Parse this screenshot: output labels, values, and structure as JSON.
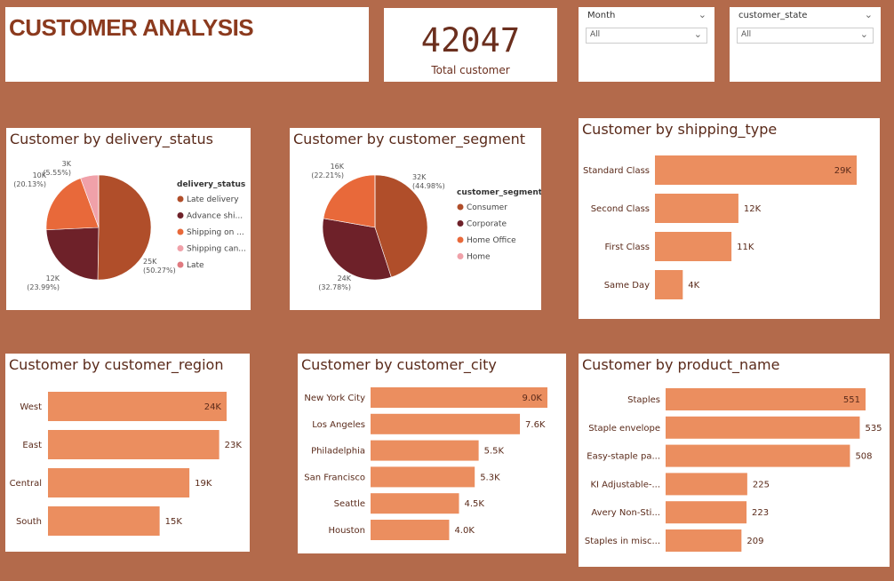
{
  "title": "CUSTOMER ANALYSIS",
  "kpi": {
    "value": "42047",
    "label": "Total customer"
  },
  "slicers": [
    {
      "title": "Month",
      "value": "All"
    },
    {
      "title": "customer_state",
      "value": "All"
    }
  ],
  "colors": {
    "background": "#B36A4B",
    "bar": "#EB8E5F",
    "pie": [
      "#B04E2A",
      "#6E2129",
      "#E8693A",
      "#F0A1A9",
      "#E07A80"
    ]
  },
  "chart_data": [
    {
      "id": "delivery",
      "type": "pie",
      "title": "Customer by delivery_status",
      "legend_title": "delivery_status",
      "legend_placement": "right",
      "labels": [
        "Late delivery",
        "Advance shi...",
        "Shipping on ...",
        "Shipping can...",
        "Late"
      ],
      "values": [
        50.27,
        23.99,
        20.13,
        5.55,
        0.06
      ],
      "data_labels": [
        {
          "value": "25K",
          "pct": "(50.27%)"
        },
        {
          "value": "12K",
          "pct": "(23.99%)"
        },
        {
          "value": "10K",
          "pct": "(20.13%)"
        },
        {
          "value": "3K",
          "pct": "(5.55%)"
        }
      ]
    },
    {
      "id": "segment",
      "type": "pie",
      "title": "Customer by customer_segment",
      "legend_title": "customer_segment",
      "legend_placement": "right",
      "labels": [
        "Consumer",
        "Corporate",
        "Home Office",
        "Home"
      ],
      "values": [
        44.98,
        32.78,
        22.21,
        0.03
      ],
      "data_labels": [
        {
          "value": "32K",
          "pct": "(44.98%)"
        },
        {
          "value": "24K",
          "pct": "(32.78%)"
        },
        {
          "value": "16K",
          "pct": "(22.21%)"
        }
      ]
    },
    {
      "id": "shipping",
      "type": "bar",
      "title": "Customer by shipping_type",
      "categories": [
        "Standard Class",
        "Second Class",
        "First Class",
        "Same Day"
      ],
      "values": [
        29000,
        12000,
        11000,
        4000
      ],
      "data_labels": [
        "29K",
        "12K",
        "11K",
        "4K"
      ]
    },
    {
      "id": "region",
      "type": "bar",
      "title": "Customer by customer_region",
      "categories": [
        "West",
        "East",
        "Central",
        "South"
      ],
      "values": [
        24000,
        23000,
        19000,
        15000
      ],
      "data_labels": [
        "24K",
        "23K",
        "19K",
        "15K"
      ]
    },
    {
      "id": "city",
      "type": "bar",
      "title": "Customer by customer_city",
      "categories": [
        "New York City",
        "Los Angeles",
        "Philadelphia",
        "San Francisco",
        "Seattle",
        "Houston"
      ],
      "values": [
        9000,
        7600,
        5500,
        5300,
        4500,
        4000
      ],
      "data_labels": [
        "9.0K",
        "7.6K",
        "5.5K",
        "5.3K",
        "4.5K",
        "4.0K"
      ]
    },
    {
      "id": "product",
      "type": "bar",
      "title": "Customer by product_name",
      "categories": [
        "Staples",
        "Staple envelope",
        "Easy-staple pa...",
        "KI Adjustable-...",
        "Avery Non-Sti...",
        "Staples in misc..."
      ],
      "values": [
        551,
        535,
        508,
        225,
        223,
        209
      ],
      "data_labels": [
        "551",
        "535",
        "508",
        "225",
        "223",
        "209"
      ]
    }
  ]
}
